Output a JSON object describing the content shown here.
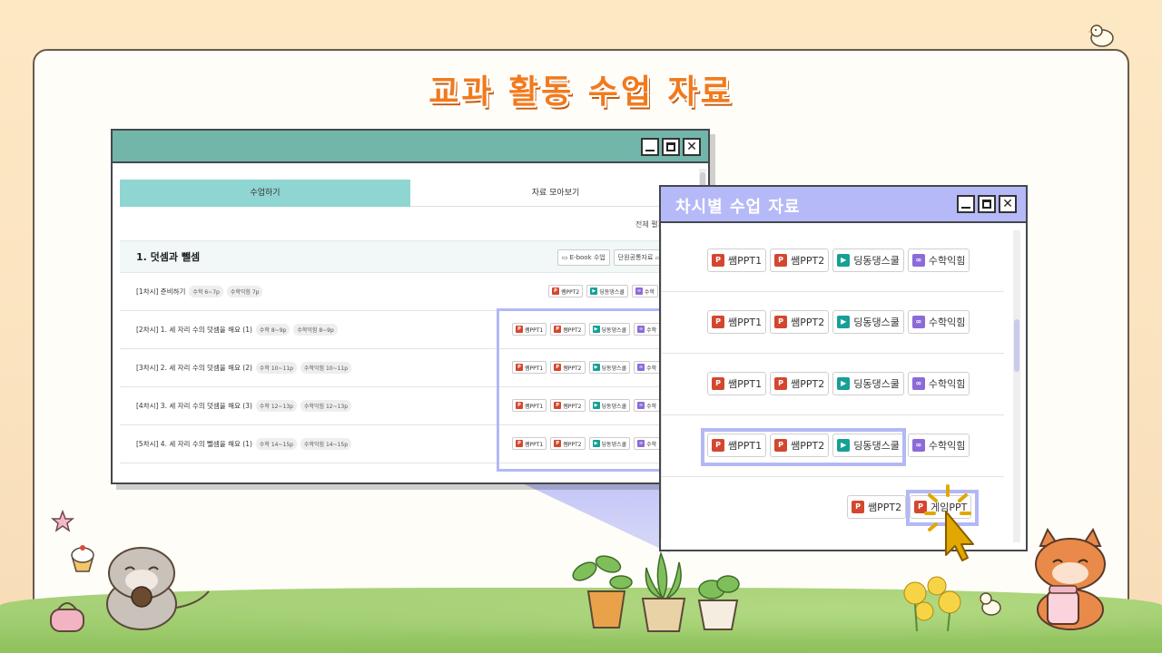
{
  "page": {
    "title": "교과 활동 수업 자료"
  },
  "main_window": {
    "tabs": [
      "수업하기",
      "자료 모아보기"
    ],
    "view_all": "전체 펼치",
    "unit": {
      "title": "1.  덧셈과 뺄셈",
      "ebook_label": "E-book 수업",
      "common_label": "단원공통자료"
    },
    "lessons": [
      {
        "title": "[1차시] 준비하기",
        "tags": [
          "수학 6~7p",
          "수학익힘 7p"
        ],
        "buttons": [
          "쌤PPT2",
          "딩동댕스쿨",
          "수학"
        ]
      },
      {
        "title": "[2차시] 1. 세 자리 수의 덧셈을 해요 (1)",
        "tags": [
          "수학 8~9p",
          "수학익힘 8~9p"
        ],
        "buttons": [
          "쌤PPT1",
          "쌤PPT2",
          "딩동댕스쿨",
          "수학"
        ]
      },
      {
        "title": "[3차시] 2. 세 자리 수의 덧셈을 해요 (2)",
        "tags": [
          "수학 10~11p",
          "수학익힘 10~11p"
        ],
        "buttons": [
          "쌤PPT1",
          "쌤PPT2",
          "딩동댕스쿨",
          "수학"
        ]
      },
      {
        "title": "[4차시] 3. 세 자리 수의 덧셈을 해요 (3)",
        "tags": [
          "수학 12~13p",
          "수학익힘 12~13p"
        ],
        "buttons": [
          "쌤PPT1",
          "쌤PPT2",
          "딩동댕스쿨",
          "수학"
        ]
      },
      {
        "title": "[5차시] 4. 세 자리 수의 뺄셈을 해요 (1)",
        "tags": [
          "수학 14~15p",
          "수학익힘 14~15p"
        ],
        "buttons": [
          "쌤PPT1",
          "쌤PPT2",
          "딩동댕스쿨",
          "수학"
        ]
      }
    ]
  },
  "popup_window": {
    "title": "차시별 수업 자료",
    "rows": [
      {
        "buttons": [
          "쌤PPT1",
          "쌤PPT2",
          "딩동댕스쿨",
          "수학익힘"
        ]
      },
      {
        "buttons": [
          "쌤PPT1",
          "쌤PPT2",
          "딩동댕스쿨",
          "수학익힘"
        ]
      },
      {
        "buttons": [
          "쌤PPT1",
          "쌤PPT2",
          "딩동댕스쿨",
          "수학익힘"
        ]
      },
      {
        "buttons": [
          "쌤PPT1",
          "쌤PPT2",
          "딩동댕스쿨",
          "수학익힘"
        ]
      },
      {
        "buttons": [
          "쌤PPT2",
          "게임PPT"
        ]
      }
    ]
  },
  "icons": {
    "ppt": "ppt-icon",
    "play": "play-icon",
    "link": "link-icon",
    "book": "book-icon",
    "folder": "folder-icon"
  },
  "colors": {
    "accent": "#f27a1c",
    "main_titlebar": "#72b6aa",
    "popup_titlebar": "#b6b9f7",
    "tab_active": "#8fd5d1",
    "ppt": "#d4472f",
    "play": "#16a096",
    "link": "#8c6bd8",
    "highlight": "#b3b8f6"
  }
}
